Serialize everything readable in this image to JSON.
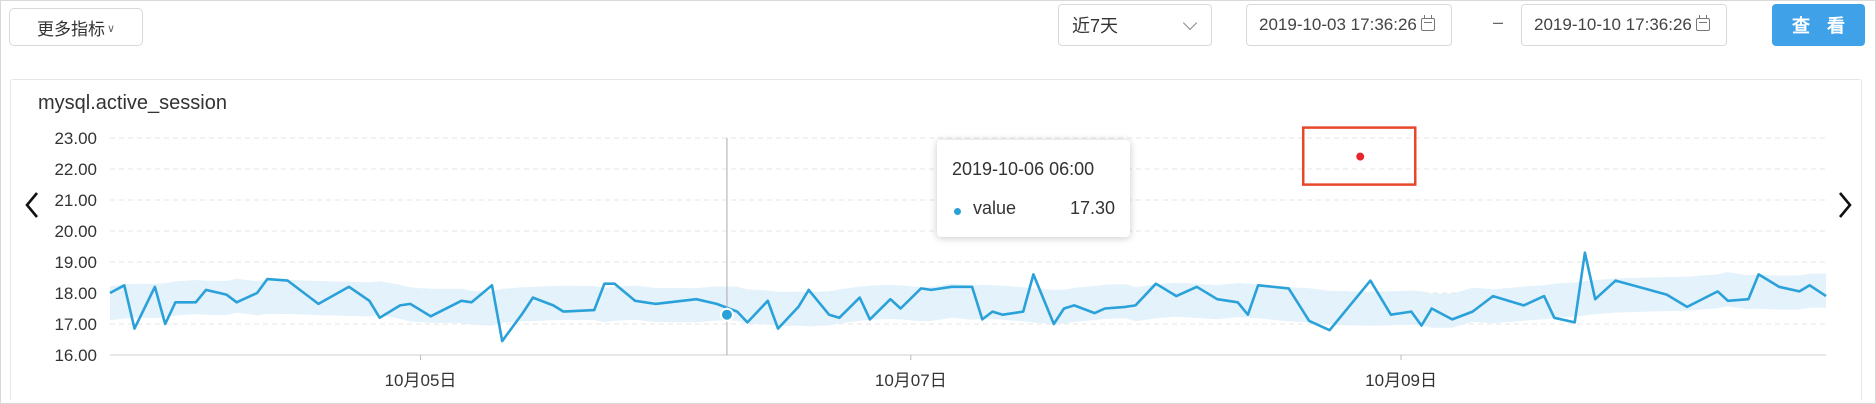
{
  "toolbar": {
    "more_metrics_label": "更多指标",
    "time_range": "近7天",
    "start_time": "2019-10-03 17:36:26",
    "range_separator": "–",
    "end_time": "2019-10-10 17:36:26",
    "query_label": "查 看"
  },
  "colors": {
    "line": "#2aa1d8",
    "band": "#dff0fb",
    "query_button": "#3fa2e8",
    "highlight": "#e8472c",
    "peak_dot": "#e8252c"
  },
  "icons": {
    "more_caret": "chevron-down-icon",
    "select_caret": "chevron-down-icon",
    "date": "calendar-icon",
    "prev": "chevron-left-icon",
    "next": "chevron-right-icon"
  },
  "tooltip": {
    "time": "2019-10-06 06:00",
    "series": "value",
    "value": "17.30"
  },
  "chart_data": {
    "type": "line",
    "title": "mysql.active_session",
    "xlabel": "",
    "ylabel": "",
    "ylim": [
      16,
      23
    ],
    "xlim": [
      "2019-10-03 17:36",
      "2019-10-10 17:36"
    ],
    "y_ticks": [
      "16.00",
      "17.00",
      "18.00",
      "19.00",
      "20.00",
      "21.00",
      "22.00",
      "23.00"
    ],
    "x_ticks": [
      {
        "date": "2019-10-05 00:00",
        "label": "10月05日"
      },
      {
        "date": "2019-10-07 00:00",
        "label": "10月07日"
      },
      {
        "date": "2019-10-09 00:00",
        "label": "10月09日"
      }
    ],
    "grid": true,
    "legend": "none",
    "hover": {
      "x": "2019-10-06 06:00",
      "y": 17.3
    },
    "peak": {
      "x": "2019-10-08 20:00",
      "y": 22.4
    },
    "series": [
      {
        "values": [
          [
            "2019-10-03 17:36",
            18.0
          ],
          [
            "2019-10-03 19:00",
            18.25
          ],
          [
            "2019-10-03 20:00",
            16.85
          ],
          [
            "2019-10-03 22:00",
            18.2
          ],
          [
            "2019-10-03 23:00",
            17.0
          ],
          [
            "2019-10-04 00:00",
            17.7
          ],
          [
            "2019-10-04 02:00",
            17.7
          ],
          [
            "2019-10-04 03:00",
            18.1
          ],
          [
            "2019-10-04 05:00",
            17.95
          ],
          [
            "2019-10-04 06:00",
            17.7
          ],
          [
            "2019-10-04 08:00",
            18.0
          ],
          [
            "2019-10-04 09:00",
            18.45
          ],
          [
            "2019-10-04 11:00",
            18.4
          ],
          [
            "2019-10-04 14:00",
            17.65
          ],
          [
            "2019-10-04 17:00",
            18.2
          ],
          [
            "2019-10-04 19:00",
            17.75
          ],
          [
            "2019-10-04 20:00",
            17.2
          ],
          [
            "2019-10-04 22:00",
            17.6
          ],
          [
            "2019-10-04 23:00",
            17.65
          ],
          [
            "2019-10-05 01:00",
            17.25
          ],
          [
            "2019-10-05 04:00",
            17.75
          ],
          [
            "2019-10-05 05:00",
            17.7
          ],
          [
            "2019-10-05 07:00",
            18.25
          ],
          [
            "2019-10-05 08:00",
            16.45
          ],
          [
            "2019-10-05 10:00",
            17.35
          ],
          [
            "2019-10-05 11:00",
            17.85
          ],
          [
            "2019-10-05 13:00",
            17.6
          ],
          [
            "2019-10-05 14:00",
            17.4
          ],
          [
            "2019-10-05 17:00",
            17.45
          ],
          [
            "2019-10-05 18:00",
            18.3
          ],
          [
            "2019-10-05 19:00",
            18.3
          ],
          [
            "2019-10-05 21:00",
            17.75
          ],
          [
            "2019-10-05 23:00",
            17.65
          ],
          [
            "2019-10-06 03:00",
            17.8
          ],
          [
            "2019-10-06 05:00",
            17.65
          ],
          [
            "2019-10-06 07:00",
            17.4
          ],
          [
            "2019-10-06 08:00",
            17.05
          ],
          [
            "2019-10-06 10:00",
            17.75
          ],
          [
            "2019-10-06 11:00",
            16.85
          ],
          [
            "2019-10-06 13:00",
            17.55
          ],
          [
            "2019-10-06 14:00",
            18.1
          ],
          [
            "2019-10-06 16:00",
            17.3
          ],
          [
            "2019-10-06 17:00",
            17.2
          ],
          [
            "2019-10-06 19:00",
            17.85
          ],
          [
            "2019-10-06 20:00",
            17.15
          ],
          [
            "2019-10-06 22:00",
            17.8
          ],
          [
            "2019-10-06 23:00",
            17.5
          ],
          [
            "2019-10-07 01:00",
            18.15
          ],
          [
            "2019-10-07 02:00",
            18.1
          ],
          [
            "2019-10-07 04:00",
            18.2
          ],
          [
            "2019-10-07 06:00",
            18.2
          ],
          [
            "2019-10-07 07:00",
            17.15
          ],
          [
            "2019-10-07 08:00",
            17.4
          ],
          [
            "2019-10-07 09:00",
            17.3
          ],
          [
            "2019-10-07 11:00",
            17.4
          ],
          [
            "2019-10-07 12:00",
            18.6
          ],
          [
            "2019-10-07 14:00",
            17.0
          ],
          [
            "2019-10-07 15:00",
            17.5
          ],
          [
            "2019-10-07 16:00",
            17.6
          ],
          [
            "2019-10-07 18:00",
            17.35
          ],
          [
            "2019-10-07 19:00",
            17.5
          ],
          [
            "2019-10-07 21:00",
            17.55
          ],
          [
            "2019-10-07 22:00",
            17.6
          ],
          [
            "2019-10-08 00:00",
            18.3
          ],
          [
            "2019-10-08 02:00",
            17.9
          ],
          [
            "2019-10-08 04:00",
            18.2
          ],
          [
            "2019-10-08 06:00",
            17.8
          ],
          [
            "2019-10-08 08:00",
            17.7
          ],
          [
            "2019-10-08 09:00",
            17.3
          ],
          [
            "2019-10-08 10:00",
            18.25
          ],
          [
            "2019-10-08 13:00",
            18.15
          ],
          [
            "2019-10-08 15:00",
            17.1
          ],
          [
            "2019-10-08 17:00",
            16.8
          ],
          [
            "2019-10-08 21:00",
            18.4
          ],
          [
            "2019-10-08 23:00",
            17.3
          ],
          [
            "2019-10-09 01:00",
            17.4
          ],
          [
            "2019-10-09 02:00",
            16.95
          ],
          [
            "2019-10-09 03:00",
            17.5
          ],
          [
            "2019-10-09 05:00",
            17.15
          ],
          [
            "2019-10-09 07:00",
            17.4
          ],
          [
            "2019-10-09 09:00",
            17.9
          ],
          [
            "2019-10-09 12:00",
            17.6
          ],
          [
            "2019-10-09 14:00",
            17.9
          ],
          [
            "2019-10-09 15:00",
            17.2
          ],
          [
            "2019-10-09 17:00",
            17.05
          ],
          [
            "2019-10-09 18:00",
            19.3
          ],
          [
            "2019-10-09 19:00",
            17.8
          ],
          [
            "2019-10-09 21:00",
            18.4
          ],
          [
            "2019-10-10 02:00",
            17.95
          ],
          [
            "2019-10-10 04:00",
            17.55
          ],
          [
            "2019-10-10 07:00",
            18.05
          ],
          [
            "2019-10-10 08:00",
            17.75
          ],
          [
            "2019-10-10 10:00",
            17.8
          ],
          [
            "2019-10-10 11:00",
            18.6
          ],
          [
            "2019-10-10 13:00",
            18.2
          ],
          [
            "2019-10-10 15:00",
            18.05
          ],
          [
            "2019-10-10 16:00",
            18.25
          ],
          [
            "2019-10-10 17:36",
            17.9
          ]
        ]
      }
    ]
  }
}
